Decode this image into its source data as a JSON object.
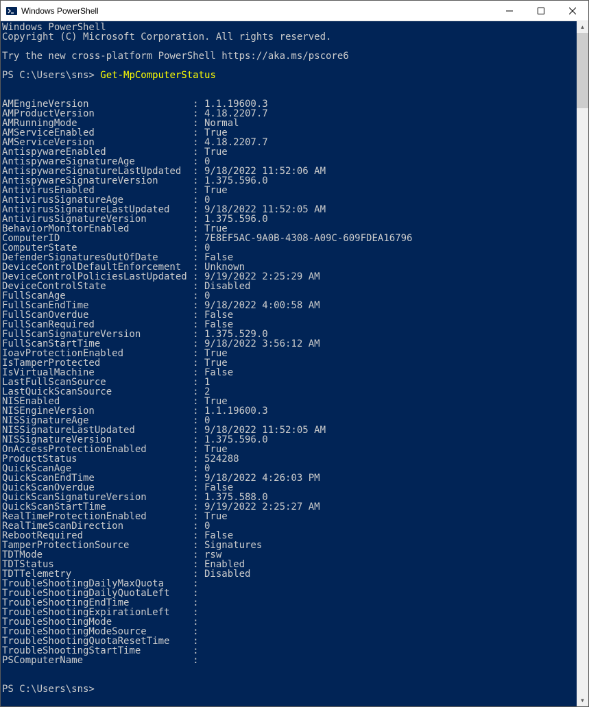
{
  "window": {
    "title": "Windows PowerShell"
  },
  "header": {
    "line1": "Windows PowerShell",
    "line2": "Copyright (C) Microsoft Corporation. All rights reserved.",
    "tip": "Try the new cross-platform PowerShell https://aka.ms/pscore6"
  },
  "prompt": {
    "prefix": "PS C:\\Users\\sns> ",
    "command": "Get-MpComputerStatus"
  },
  "rows": [
    {
      "k": "AMEngineVersion",
      "v": "1.1.19600.3"
    },
    {
      "k": "AMProductVersion",
      "v": "4.18.2207.7"
    },
    {
      "k": "AMRunningMode",
      "v": "Normal"
    },
    {
      "k": "AMServiceEnabled",
      "v": "True"
    },
    {
      "k": "AMServiceVersion",
      "v": "4.18.2207.7"
    },
    {
      "k": "AntispywareEnabled",
      "v": "True"
    },
    {
      "k": "AntispywareSignatureAge",
      "v": "0"
    },
    {
      "k": "AntispywareSignatureLastUpdated",
      "v": "9/18/2022 11:52:06 AM"
    },
    {
      "k": "AntispywareSignatureVersion",
      "v": "1.375.596.0"
    },
    {
      "k": "AntivirusEnabled",
      "v": "True"
    },
    {
      "k": "AntivirusSignatureAge",
      "v": "0"
    },
    {
      "k": "AntivirusSignatureLastUpdated",
      "v": "9/18/2022 11:52:05 AM"
    },
    {
      "k": "AntivirusSignatureVersion",
      "v": "1.375.596.0"
    },
    {
      "k": "BehaviorMonitorEnabled",
      "v": "True"
    },
    {
      "k": "ComputerID",
      "v": "7E8EF5AC-9A0B-4308-A09C-609FDEA16796"
    },
    {
      "k": "ComputerState",
      "v": "0"
    },
    {
      "k": "DefenderSignaturesOutOfDate",
      "v": "False"
    },
    {
      "k": "DeviceControlDefaultEnforcement",
      "v": "Unknown"
    },
    {
      "k": "DeviceControlPoliciesLastUpdated",
      "v": "9/19/2022 2:25:29 AM"
    },
    {
      "k": "DeviceControlState",
      "v": "Disabled"
    },
    {
      "k": "FullScanAge",
      "v": "0"
    },
    {
      "k": "FullScanEndTime",
      "v": "9/18/2022 4:00:58 AM"
    },
    {
      "k": "FullScanOverdue",
      "v": "False"
    },
    {
      "k": "FullScanRequired",
      "v": "False"
    },
    {
      "k": "FullScanSignatureVersion",
      "v": "1.375.529.0"
    },
    {
      "k": "FullScanStartTime",
      "v": "9/18/2022 3:56:12 AM"
    },
    {
      "k": "IoavProtectionEnabled",
      "v": "True"
    },
    {
      "k": "IsTamperProtected",
      "v": "True"
    },
    {
      "k": "IsVirtualMachine",
      "v": "False"
    },
    {
      "k": "LastFullScanSource",
      "v": "1"
    },
    {
      "k": "LastQuickScanSource",
      "v": "2"
    },
    {
      "k": "NISEnabled",
      "v": "True"
    },
    {
      "k": "NISEngineVersion",
      "v": "1.1.19600.3"
    },
    {
      "k": "NISSignatureAge",
      "v": "0"
    },
    {
      "k": "NISSignatureLastUpdated",
      "v": "9/18/2022 11:52:05 AM"
    },
    {
      "k": "NISSignatureVersion",
      "v": "1.375.596.0"
    },
    {
      "k": "OnAccessProtectionEnabled",
      "v": "True"
    },
    {
      "k": "ProductStatus",
      "v": "524288"
    },
    {
      "k": "QuickScanAge",
      "v": "0"
    },
    {
      "k": "QuickScanEndTime",
      "v": "9/18/2022 4:26:03 PM"
    },
    {
      "k": "QuickScanOverdue",
      "v": "False"
    },
    {
      "k": "QuickScanSignatureVersion",
      "v": "1.375.588.0"
    },
    {
      "k": "QuickScanStartTime",
      "v": "9/19/2022 2:25:27 AM"
    },
    {
      "k": "RealTimeProtectionEnabled",
      "v": "True"
    },
    {
      "k": "RealTimeScanDirection",
      "v": "0"
    },
    {
      "k": "RebootRequired",
      "v": "False"
    },
    {
      "k": "TamperProtectionSource",
      "v": "Signatures"
    },
    {
      "k": "TDTMode",
      "v": "rsw"
    },
    {
      "k": "TDTStatus",
      "v": "Enabled"
    },
    {
      "k": "TDTTelemetry",
      "v": "Disabled"
    },
    {
      "k": "TroubleShootingDailyMaxQuota",
      "v": ""
    },
    {
      "k": "TroubleShootingDailyQuotaLeft",
      "v": ""
    },
    {
      "k": "TroubleShootingEndTime",
      "v": ""
    },
    {
      "k": "TroubleShootingExpirationLeft",
      "v": ""
    },
    {
      "k": "TroubleShootingMode",
      "v": ""
    },
    {
      "k": "TroubleShootingModeSource",
      "v": ""
    },
    {
      "k": "TroubleShootingQuotaResetTime",
      "v": ""
    },
    {
      "k": "TroubleShootingStartTime",
      "v": ""
    },
    {
      "k": "PSComputerName",
      "v": ""
    }
  ],
  "prompt2": {
    "prefix": "PS C:\\Users\\sns> "
  },
  "layout": {
    "keyWidth": 33
  }
}
